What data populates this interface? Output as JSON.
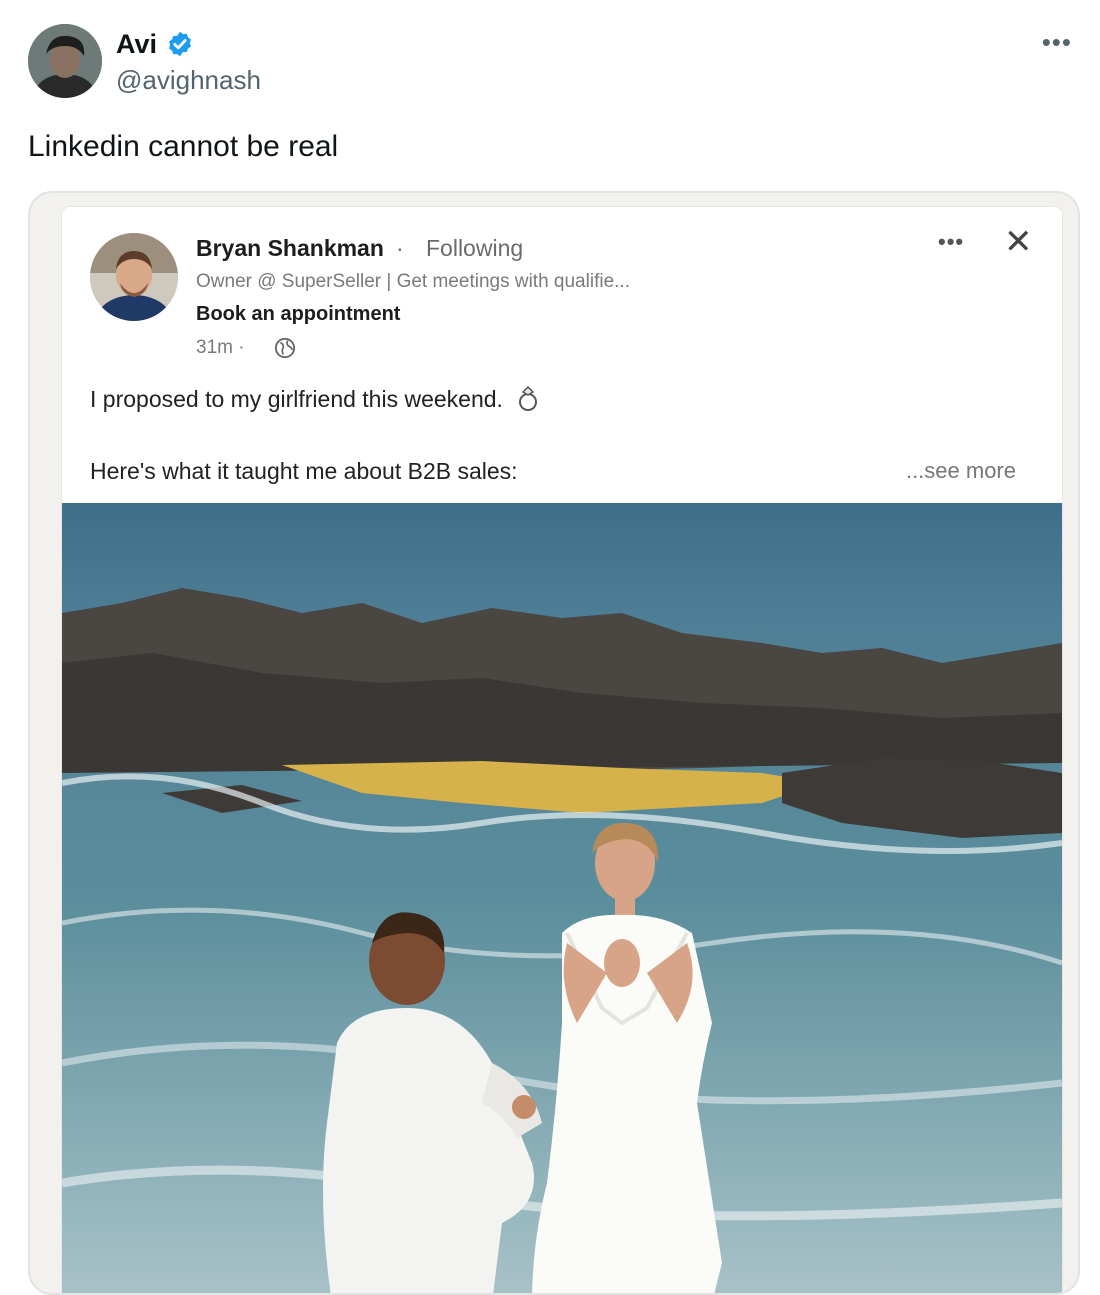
{
  "tweet": {
    "author": {
      "name": "Avi",
      "handle": "@avighnash",
      "verified_icon": "verified-badge-icon"
    },
    "more_icon": "•••",
    "text": "Linkedin cannot be real"
  },
  "linkedin_post": {
    "author_name": "Bryan Shankman",
    "separator": "·",
    "follow_status": "Following",
    "headline": "Owner @ SuperSeller | Get meetings with qualifie...",
    "cta": "Book an appointment",
    "time": "31m ·",
    "more_icon": "•••",
    "close_icon": "✕",
    "body_line1": "I proposed to my girlfriend this weekend.",
    "body_line2": "Here's what it taught me about B2B sales:",
    "see_more": "...see more"
  },
  "colors": {
    "text_primary": "#0f1419",
    "text_secondary": "#536471",
    "verified_blue": "#1d9bf0",
    "embed_background": "#f2f1ee"
  }
}
